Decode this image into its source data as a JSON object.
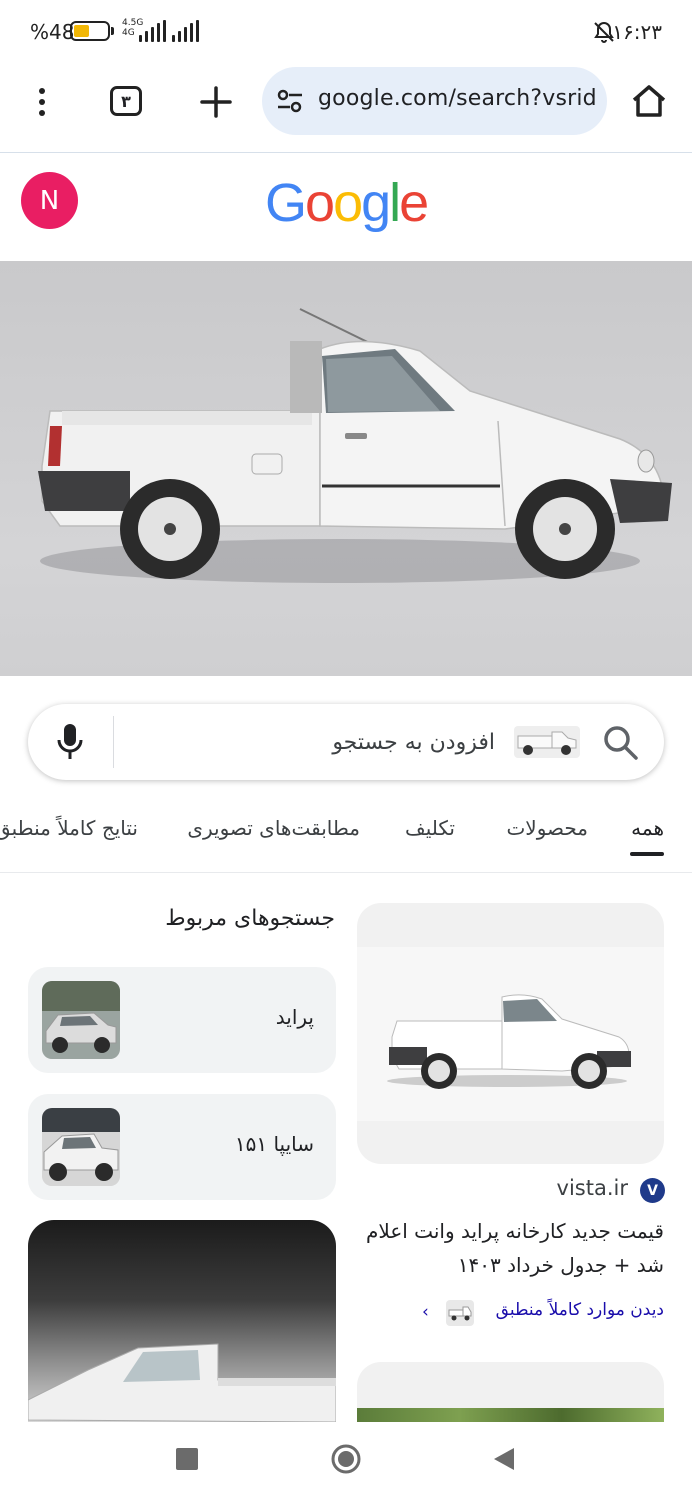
{
  "status_bar": {
    "battery_percent": "%48",
    "battery_level": 0.48,
    "network_type": "4.5G",
    "network_sub": "4G",
    "clock": "۱۶:۲۳",
    "icons": [
      "battery-icon",
      "signal-icon",
      "silent-bell-icon"
    ]
  },
  "browser": {
    "url": "google.com/search?vsrid",
    "tab_count": "۳",
    "icons": [
      "menu-icon",
      "tab-switcher-icon",
      "new-tab-icon",
      "site-settings-icon",
      "home-icon"
    ]
  },
  "header": {
    "avatar_letter": "N",
    "avatar_color": "#e91e63",
    "logo": "Google",
    "logo_colors": [
      "#4285F4",
      "#EA4335",
      "#FBBC05",
      "#4285F4",
      "#34A853",
      "#EA4335"
    ]
  },
  "search": {
    "placeholder": "افزودن به جستجو"
  },
  "tabs": [
    {
      "label": "همه",
      "active": true
    },
    {
      "label": "محصولات",
      "active": false
    },
    {
      "label": "تکلیف",
      "active": false
    },
    {
      "label": "مطابقت‌های تصویری",
      "active": false
    },
    {
      "label": "نتایج کاملاً منطبق",
      "active": false
    }
  ],
  "result": {
    "source": "vista.ir",
    "source_icon_letter": "V",
    "title": "قیمت جدید کارخانه پراید وانت اعلام شد + جدول خرداد ۱۴۰۳",
    "exact_matches_link": "دیدن موارد کاملاً منطبق"
  },
  "related": {
    "title": "جستجوهای مربوط",
    "items": [
      {
        "label": "پراید"
      },
      {
        "label": "سایپا ۱۵۱"
      }
    ]
  },
  "nav": {
    "icons": [
      "recent-apps-icon",
      "home-icon",
      "back-icon"
    ]
  }
}
